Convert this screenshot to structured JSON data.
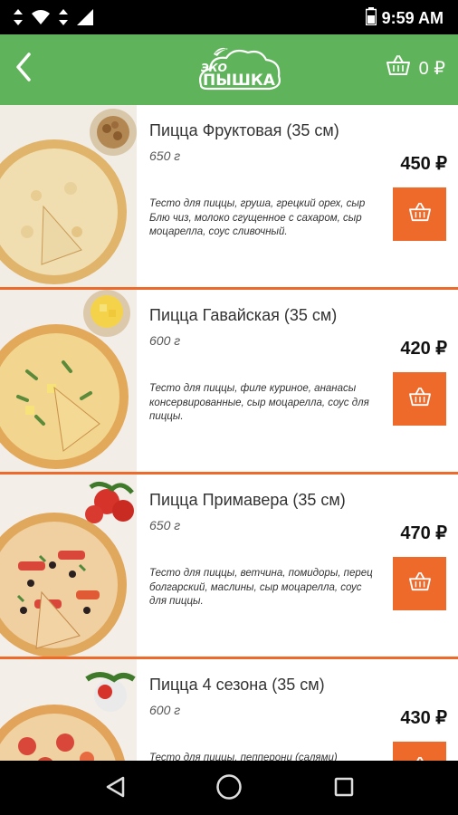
{
  "status_bar": {
    "time": "9:59 AM"
  },
  "header": {
    "logo_top": "ЭКО",
    "logo_main": "ПЫШКА",
    "cart_total": "0 ₽"
  },
  "products": [
    {
      "title": "Пицца Фруктовая (35 см)",
      "weight": "650 г",
      "description": "Тесто для пиццы, груша, грецкий орех, сыр Блю чиз, молоко сгущенное с сахаром, сыр моцарелла, соус сливочный.",
      "price": "450 ₽"
    },
    {
      "title": "Пицца Гавайская (35 см)",
      "weight": "600 г",
      "description": "Тесто для пиццы, филе куриное, ананасы консервированные, сыр моцарелла, соус для пиццы.",
      "price": "420 ₽"
    },
    {
      "title": "Пицца Примавера (35 см)",
      "weight": "650 г",
      "description": "Тесто для пиццы, ветчина, помидоры, перец болгарский, маслины, сыр моцарелла, соус для пиццы.",
      "price": "470 ₽"
    },
    {
      "title": "Пицца 4 сезона (35 см)",
      "weight": "600 г",
      "description": "Тесто для пиццы, пепперони (салями)",
      "price": "430 ₽"
    }
  ],
  "colors": {
    "header_green": "#5fb35a",
    "accent_orange": "#ee6a2b"
  },
  "icons": {
    "back": "chevron-left-icon",
    "cart": "basket-icon",
    "nav_back": "triangle-back-icon",
    "nav_home": "circle-home-icon",
    "nav_recent": "square-recents-icon"
  }
}
